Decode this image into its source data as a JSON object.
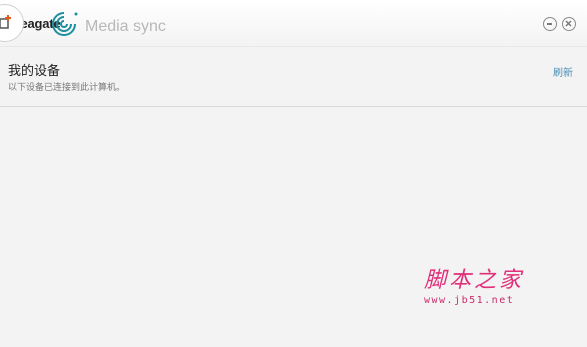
{
  "window": {
    "logo_text": "Seagate",
    "app_title": "Media sync"
  },
  "devices": {
    "title": "我的设备",
    "subtitle": "以下设备已连接到此计算机。",
    "refresh_label": "刷新"
  },
  "watermark": {
    "main_text": "脚本之家",
    "url": "www.jb51.net"
  },
  "colors": {
    "accent": "#4a8fb8",
    "brand_teal": "#1a8fa0",
    "watermark": "#e0307a"
  },
  "icons": {
    "minimize": "minus-circle-icon",
    "close": "x-circle-icon",
    "logo": "seagate-spiral-logo-icon",
    "badge": "plus-badge-icon"
  }
}
